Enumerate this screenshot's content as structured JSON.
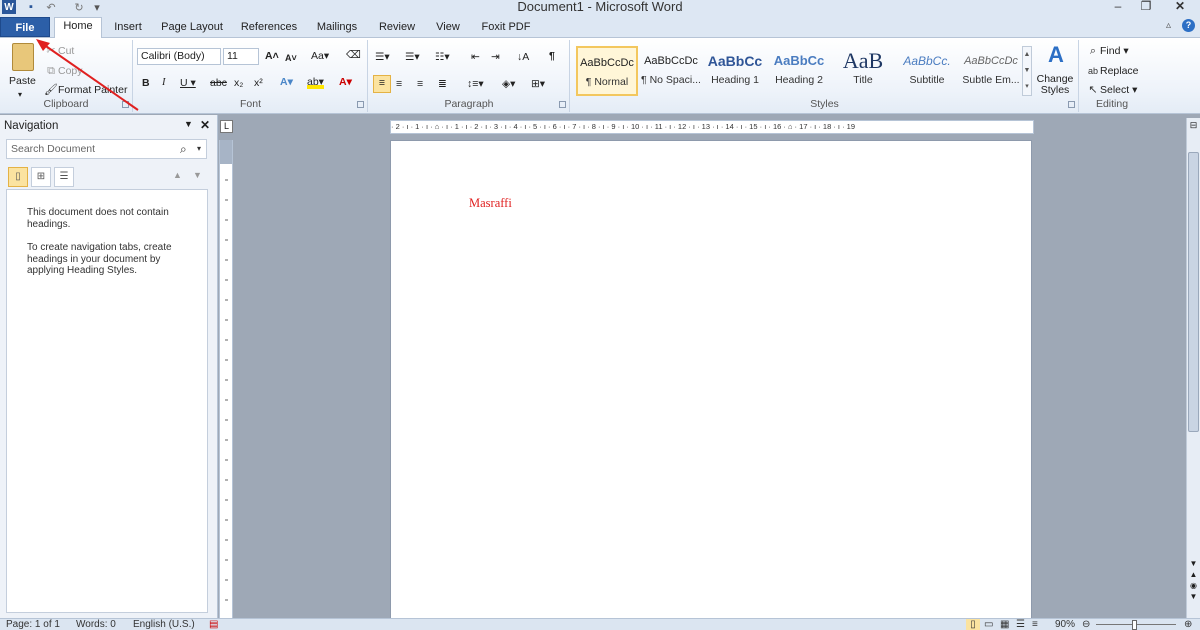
{
  "window": {
    "title": "Document1 - Microsoft Word"
  },
  "quick_access": {
    "icons": [
      "word-logo-icon",
      "save-icon",
      "undo-icon",
      "redo-icon"
    ]
  },
  "tabs": {
    "file": "File",
    "items": [
      "Home",
      "Insert",
      "Page Layout",
      "References",
      "Mailings",
      "Review",
      "View",
      "Foxit PDF"
    ]
  },
  "clipboard": {
    "paste": "Paste",
    "cut": "Cut",
    "copy": "Copy",
    "format_painter": "Format Painter",
    "group": "Clipboard"
  },
  "font": {
    "name": "Calibri (Body)",
    "size": "11",
    "group": "Font"
  },
  "paragraph": {
    "group": "Paragraph"
  },
  "styles": {
    "group": "Styles",
    "items": [
      {
        "preview": "AaBbCcDc",
        "name": "¶ Normal"
      },
      {
        "preview": "AaBbCcDc",
        "name": "¶ No Spaci..."
      },
      {
        "preview": "AaBbCc",
        "name": "Heading 1"
      },
      {
        "preview": "AaBbCc",
        "name": "Heading 2"
      },
      {
        "preview": "AaB",
        "name": "Title"
      },
      {
        "preview": "AaBbCc.",
        "name": "Subtitle"
      },
      {
        "preview": "AaBbCcDc",
        "name": "Subtle Em..."
      }
    ],
    "change_styles": "Change Styles"
  },
  "editing": {
    "find": "Find",
    "replace": "Replace",
    "select": "Select",
    "group": "Editing"
  },
  "navigation": {
    "title": "Navigation",
    "search_placeholder": "Search Document",
    "message1": "This document does not contain headings.",
    "message2": "To create navigation tabs, create headings in your document by applying Heading Styles."
  },
  "document": {
    "text": "Masraffi",
    "text_color": "#e02020"
  },
  "ruler": {
    "h": "· 2 · ı · 1 · ı · ⌂ · ı · 1 · ı · 2 · ı · 3 · ı · 4 · ı · 5 · ı · 6 · ı · 7 · ı · 8 · ı · 9 · ı · 10 · ı · 11 · ı · 12 · ı · 13 · ı · 14 · ı · 15 · ı · 16 · ⌂ · 17 · ı · 18 · ı · 19"
  },
  "status": {
    "page": "Page: 1 of 1",
    "words": "Words: 0",
    "language": "English (U.S.)",
    "zoom": "90%"
  },
  "colors": {
    "accent": "#2c5fa8",
    "annotation_arrow": "#e02020"
  }
}
